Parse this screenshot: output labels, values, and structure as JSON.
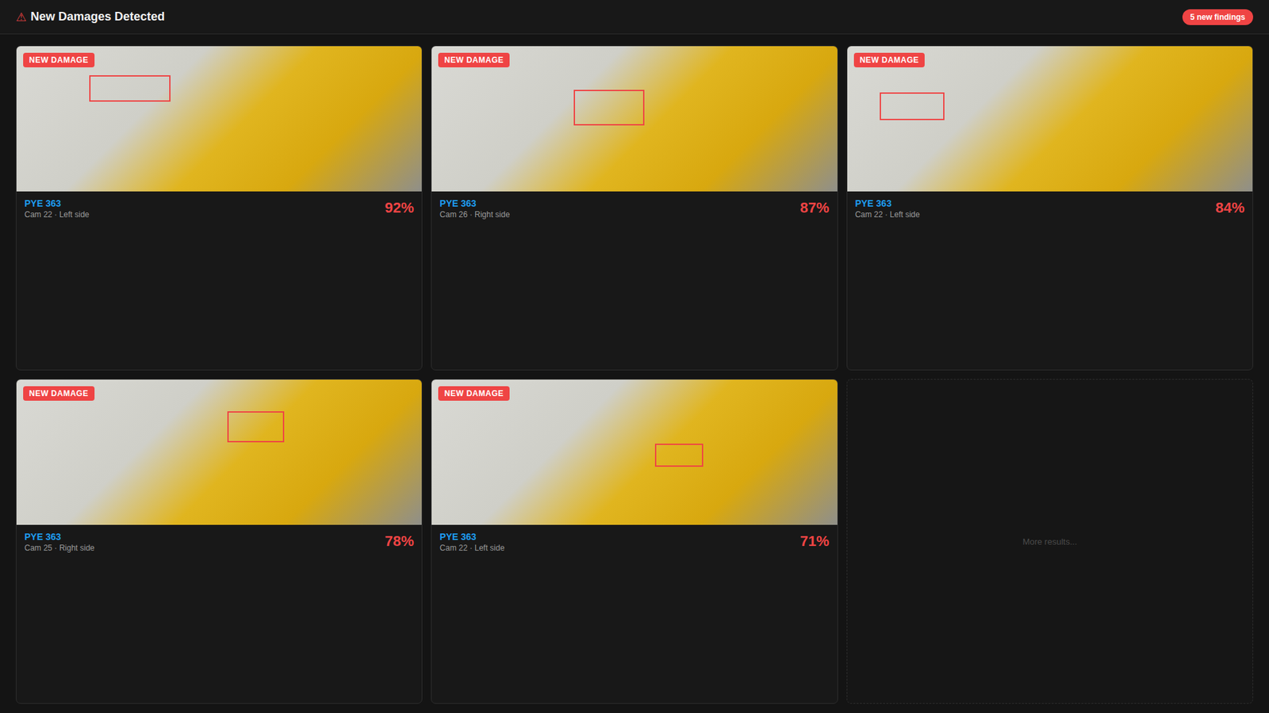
{
  "header": {
    "icon": "⚠",
    "title": "New Damages Detected",
    "badge": "5 new findings"
  },
  "findings": [
    {
      "badge": "NEW DAMAGE",
      "plate": "PYE 363",
      "camera": "Cam 22 · Left side",
      "confidence": "92%",
      "region": [
        0.18,
        0.2,
        0.2,
        0.18
      ]
    },
    {
      "badge": "NEW DAMAGE",
      "plate": "PYE 363",
      "camera": "Cam 26 · Right side",
      "confidence": "87%",
      "region": [
        0.35,
        0.3,
        0.175,
        0.245
      ]
    },
    {
      "badge": "NEW DAMAGE",
      "plate": "PYE 363",
      "camera": "Cam 22 · Left side",
      "confidence": "84%",
      "region": [
        0.08,
        0.32,
        0.16,
        0.19
      ]
    },
    {
      "badge": "NEW DAMAGE",
      "plate": "PYE 363",
      "camera": "Cam 25 · Right side",
      "confidence": "78%",
      "region": [
        0.52,
        0.22,
        0.14,
        0.21
      ]
    },
    {
      "badge": "NEW DAMAGE",
      "plate": "PYE 363",
      "camera": "Cam 22 · Left side",
      "confidence": "71%",
      "region": [
        0.55,
        0.44,
        0.12,
        0.16
      ]
    }
  ],
  "more": "More results..."
}
